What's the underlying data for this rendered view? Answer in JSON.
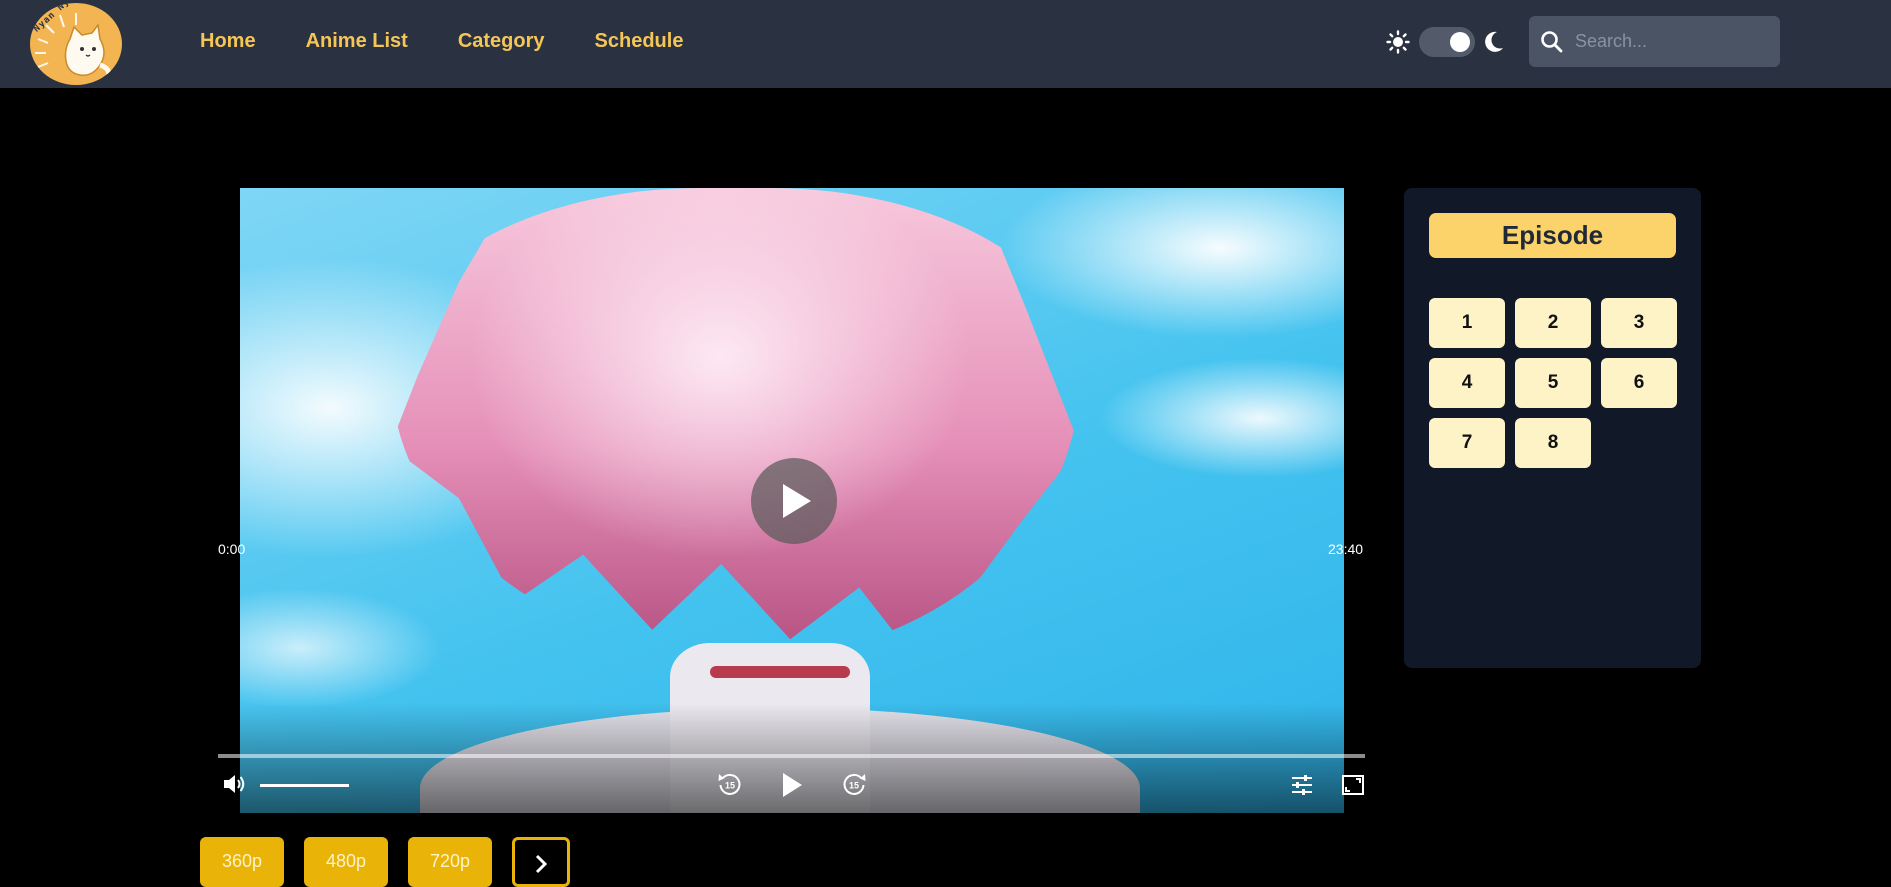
{
  "brand": {
    "logo_text": "Nyan Nyan!",
    "accent": "#f5c656",
    "navbar_bg": "#2a3140"
  },
  "nav": {
    "items": [
      {
        "label": "Home"
      },
      {
        "label": "Anime List"
      },
      {
        "label": "Category"
      },
      {
        "label": "Schedule"
      }
    ]
  },
  "theme_toggle": {
    "light_icon": "sun-icon",
    "dark_icon": "moon-icon",
    "mode": "dark"
  },
  "search": {
    "placeholder": "Search...",
    "value": "",
    "icon": "search-icon"
  },
  "player": {
    "current_time": "0:00",
    "duration": "23:40",
    "progress": 0,
    "volume": 1,
    "controls": {
      "volume_icon": "volume-icon",
      "rewind_icon": "rewind-15-icon",
      "play_icon": "play-icon",
      "forward_icon": "forward-15-icon",
      "settings_icon": "settings-sliders-icon",
      "fullscreen_icon": "fullscreen-icon"
    }
  },
  "episodes": {
    "title": "Episode",
    "items": [
      "1",
      "2",
      "3",
      "4",
      "5",
      "6",
      "7",
      "8"
    ]
  },
  "quality": {
    "options": [
      "360p",
      "480p",
      "720p"
    ],
    "next_icon": "chevron-right-icon"
  }
}
